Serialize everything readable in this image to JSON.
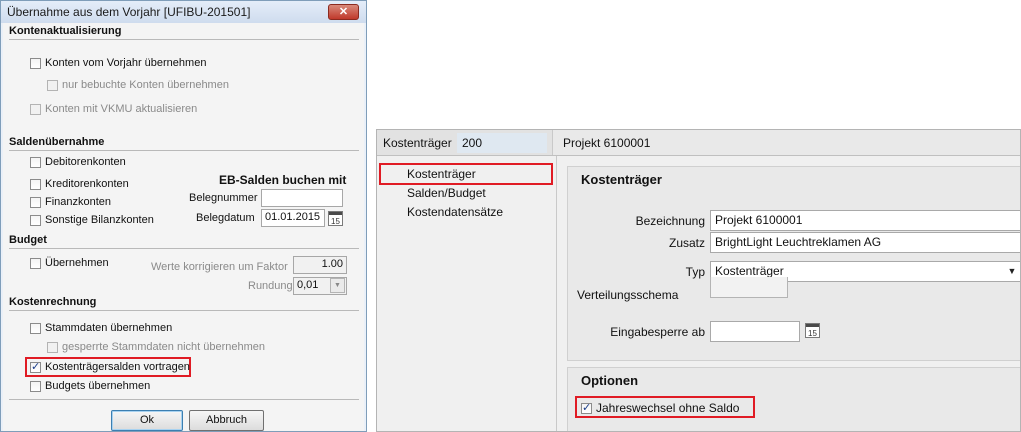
{
  "dialog": {
    "title": "Übernahme aus dem Vorjahr [UFIBU-201501]",
    "close_glyph": "✕",
    "kontenaktualisierung": {
      "title": "Kontenaktualisierung",
      "konten_vorjahr": "Konten vom Vorjahr übernehmen",
      "nur_bebuchte": "nur bebuchte Konten übernehmen",
      "vkmu": "Konten mit VKMU aktualisieren"
    },
    "saldenuebernahme": {
      "title": "Saldenübernahme",
      "items": [
        "Debitorenkonten",
        "Kreditorenkonten",
        "Finanzkonten",
        "Sonstige Bilanzkonten"
      ],
      "eb_title": "EB-Salden buchen mit",
      "belegnummer_label": "Belegnummer",
      "belegnummer_value": "",
      "belegdatum_label": "Belegdatum",
      "belegdatum_value": "01.01.2015",
      "calendar_glyph": "15"
    },
    "budget": {
      "title": "Budget",
      "uebernehmen": "Übernehmen",
      "faktor_label": "Werte korrigieren um Faktor",
      "faktor_value": "1.00",
      "rundung_label": "Rundung",
      "rundung_value": "0,01",
      "dropdown_glyph": "▼"
    },
    "kostenrechnung": {
      "title": "Kostenrechnung",
      "stammdaten": "Stammdaten übernehmen",
      "gesperrte": "gesperrte Stammdaten nicht übernehmen",
      "kostentraegersalden": "Kostenträgersalden vortragen",
      "budgets": "Budgets übernehmen"
    },
    "buttons": {
      "ok": "Ok",
      "abbruch": "Abbruch"
    }
  },
  "panel": {
    "header": {
      "label": "Kostenträger",
      "number": "200",
      "name": "Projekt 6100001"
    },
    "nav": [
      "Kostenträger",
      "Salden/Budget",
      "Kostendatensätze"
    ],
    "kostentraeger": {
      "title": "Kostenträger",
      "bezeichnung_label": "Bezeichnung",
      "bezeichnung_value": "Projekt 6100001",
      "zusatz_label": "Zusatz",
      "zusatz_value": "BrightLight Leuchtreklamen AG",
      "typ_label": "Typ",
      "typ_value": "Kostenträger",
      "verteilungsschema_label": "Verteilungsschema",
      "eingabesperre_label": "Eingabesperre ab",
      "eingabesperre_value": "",
      "calendar_glyph": "15",
      "dropdown_glyph": "▼"
    },
    "optionen": {
      "title": "Optionen",
      "jahreswechsel": "Jahreswechsel ohne Saldo"
    }
  },
  "colors": {
    "highlight": "#e01b24",
    "title_bar": "#cfdcee",
    "close_button": "#c0392b"
  }
}
